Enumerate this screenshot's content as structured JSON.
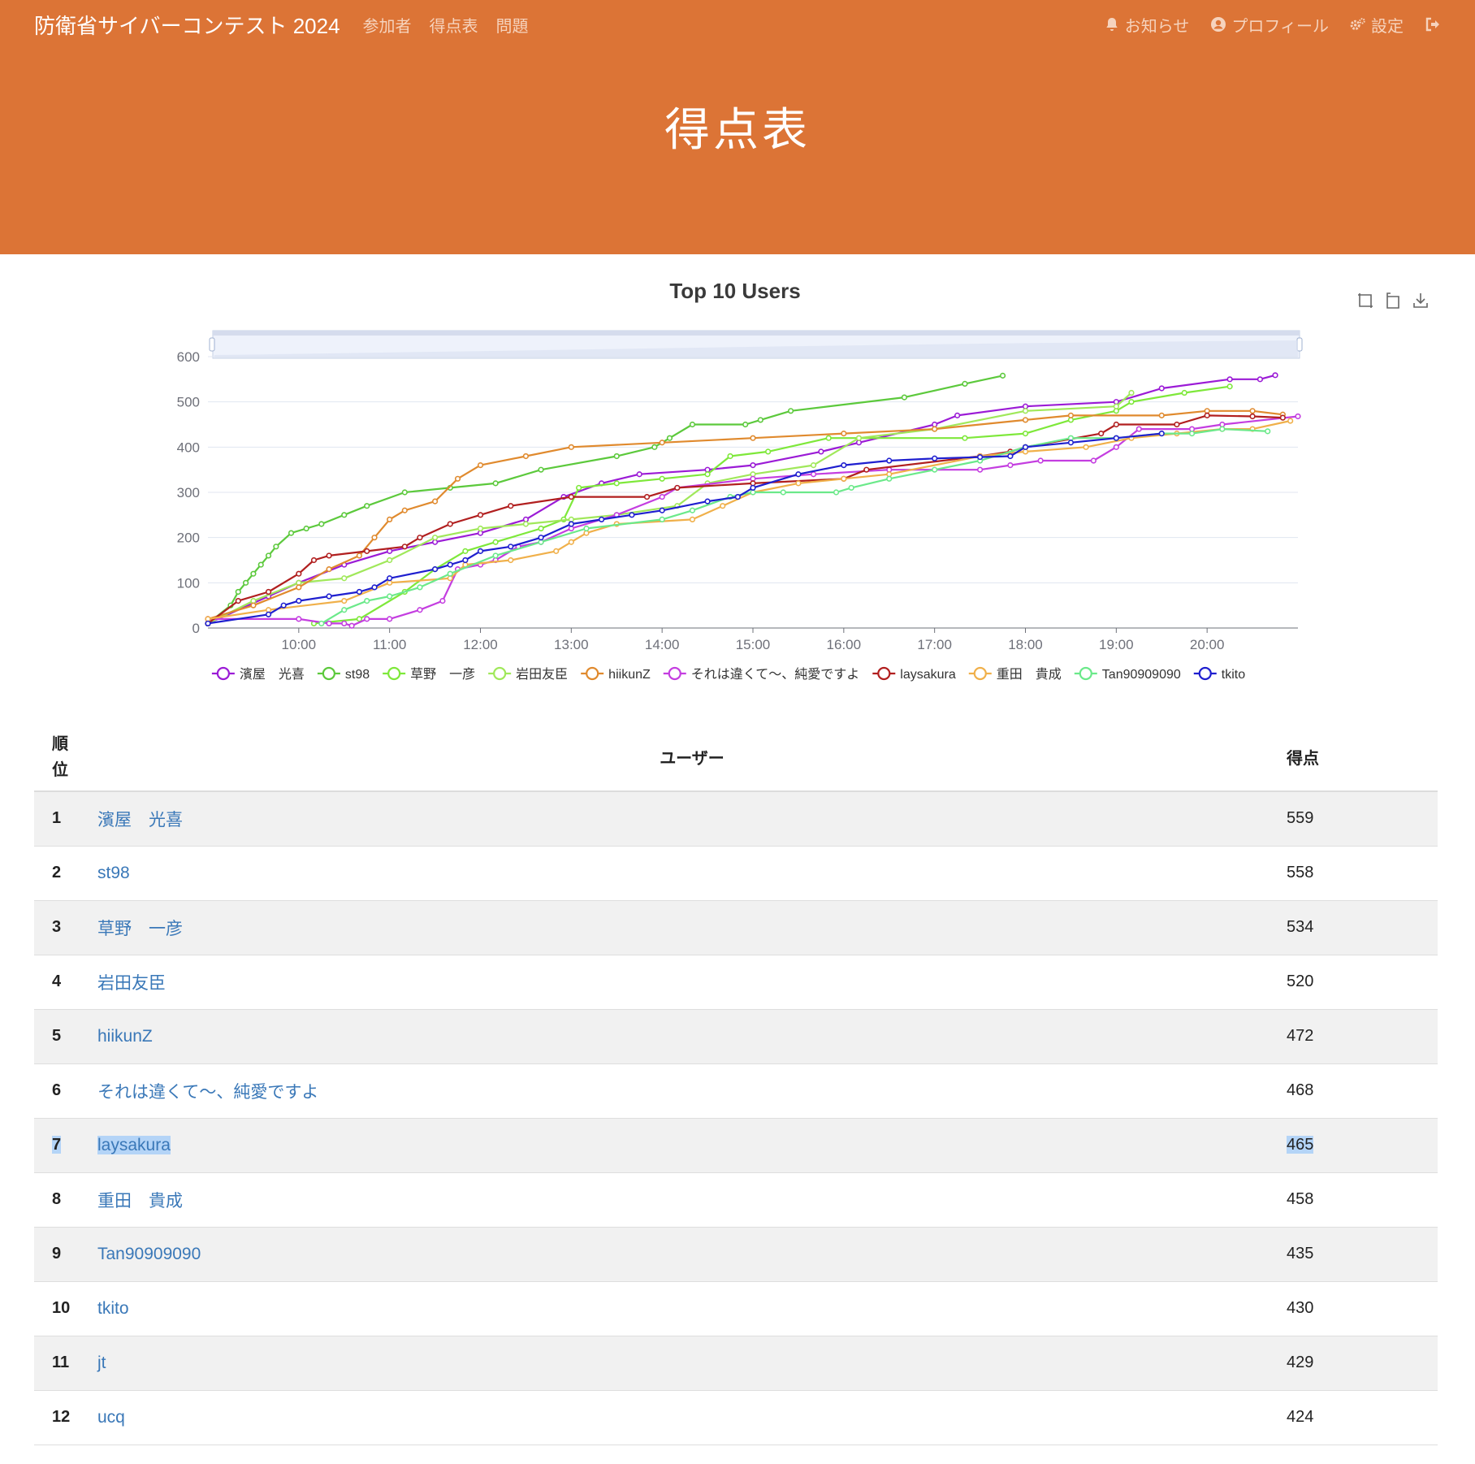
{
  "navbar": {
    "brand": "防衛省サイバーコンテスト 2024",
    "links": [
      "参加者",
      "得点表",
      "問題"
    ],
    "notifications": "お知らせ",
    "profile": "プロフィール",
    "settings": "設定"
  },
  "page": {
    "title": "得点表"
  },
  "table": {
    "headers": {
      "rank": "順位",
      "user": "ユーザー",
      "score": "得点"
    },
    "rows": [
      {
        "rank": "1",
        "user": "濱屋　光喜",
        "score": "559"
      },
      {
        "rank": "2",
        "user": "st98",
        "score": "558"
      },
      {
        "rank": "3",
        "user": "草野　一彦",
        "score": "534"
      },
      {
        "rank": "4",
        "user": "岩田友臣",
        "score": "520"
      },
      {
        "rank": "5",
        "user": "hiikunZ",
        "score": "472"
      },
      {
        "rank": "6",
        "user": "それは違くて〜、純愛ですよ",
        "score": "468"
      },
      {
        "rank": "7",
        "user": "laysakura",
        "score": "465"
      },
      {
        "rank": "8",
        "user": "重田　貴成",
        "score": "458"
      },
      {
        "rank": "9",
        "user": "Tan90909090",
        "score": "435"
      },
      {
        "rank": "10",
        "user": "tkito",
        "score": "430"
      },
      {
        "rank": "11",
        "user": "jt",
        "score": "429"
      },
      {
        "rank": "12",
        "user": "ucq",
        "score": "424"
      }
    ]
  },
  "chart_data": {
    "type": "line",
    "title": "Top 10 Users",
    "x_ticks": [
      "10:00",
      "11:00",
      "12:00",
      "13:00",
      "14:00",
      "15:00",
      "16:00",
      "17:00",
      "18:00",
      "19:00",
      "20:00"
    ],
    "xlim": [
      "09:00",
      "21:00"
    ],
    "y_ticks": [
      0,
      100,
      200,
      300,
      400,
      500,
      600
    ],
    "ylim": [
      0,
      600
    ],
    "grid": true,
    "legend_position": "bottom",
    "series": [
      {
        "name": "濱屋　光喜",
        "color": "#9b1bd6",
        "points": [
          [
            "09:00",
            10
          ],
          [
            "09:40",
            70
          ],
          [
            "10:00",
            100
          ],
          [
            "10:30",
            140
          ],
          [
            "11:00",
            170
          ],
          [
            "11:30",
            190
          ],
          [
            "12:00",
            210
          ],
          [
            "12:30",
            240
          ],
          [
            "12:55",
            290
          ],
          [
            "13:20",
            320
          ],
          [
            "13:45",
            340
          ],
          [
            "14:30",
            350
          ],
          [
            "15:00",
            360
          ],
          [
            "15:45",
            390
          ],
          [
            "16:10",
            410
          ],
          [
            "17:00",
            450
          ],
          [
            "17:15",
            470
          ],
          [
            "18:00",
            490
          ],
          [
            "19:00",
            500
          ],
          [
            "19:30",
            530
          ],
          [
            "20:15",
            550
          ],
          [
            "20:35",
            550
          ],
          [
            "20:45",
            559
          ]
        ]
      },
      {
        "name": "st98",
        "color": "#5cc93c",
        "points": [
          [
            "09:00",
            10
          ],
          [
            "09:15",
            50
          ],
          [
            "09:20",
            80
          ],
          [
            "09:25",
            100
          ],
          [
            "09:30",
            120
          ],
          [
            "09:35",
            140
          ],
          [
            "09:40",
            160
          ],
          [
            "09:45",
            180
          ],
          [
            "09:55",
            210
          ],
          [
            "10:05",
            220
          ],
          [
            "10:15",
            230
          ],
          [
            "10:30",
            250
          ],
          [
            "10:45",
            270
          ],
          [
            "11:10",
            300
          ],
          [
            "11:40",
            310
          ],
          [
            "12:10",
            320
          ],
          [
            "12:40",
            350
          ],
          [
            "13:30",
            380
          ],
          [
            "13:55",
            400
          ],
          [
            "14:05",
            420
          ],
          [
            "14:20",
            450
          ],
          [
            "14:55",
            450
          ],
          [
            "15:05",
            460
          ],
          [
            "15:25",
            480
          ],
          [
            "16:40",
            510
          ],
          [
            "17:20",
            540
          ],
          [
            "17:45",
            558
          ]
        ]
      },
      {
        "name": "草野　一彦",
        "color": "#7ee83a",
        "points": [
          [
            "10:10",
            10
          ],
          [
            "10:40",
            20
          ],
          [
            "11:10",
            80
          ],
          [
            "11:30",
            130
          ],
          [
            "11:50",
            170
          ],
          [
            "12:10",
            190
          ],
          [
            "12:40",
            220
          ],
          [
            "12:55",
            240
          ],
          [
            "13:05",
            310
          ],
          [
            "13:30",
            320
          ],
          [
            "14:00",
            330
          ],
          [
            "14:30",
            340
          ],
          [
            "14:45",
            380
          ],
          [
            "15:10",
            390
          ],
          [
            "15:50",
            420
          ],
          [
            "17:20",
            420
          ],
          [
            "18:00",
            430
          ],
          [
            "18:30",
            460
          ],
          [
            "19:00",
            480
          ],
          [
            "19:10",
            500
          ],
          [
            "19:45",
            520
          ],
          [
            "20:15",
            534
          ]
        ]
      },
      {
        "name": "岩田友臣",
        "color": "#a0e85a",
        "points": [
          [
            "09:00",
            10
          ],
          [
            "09:30",
            60
          ],
          [
            "10:00",
            100
          ],
          [
            "10:30",
            110
          ],
          [
            "11:00",
            150
          ],
          [
            "11:30",
            200
          ],
          [
            "12:00",
            220
          ],
          [
            "12:30",
            230
          ],
          [
            "13:00",
            240
          ],
          [
            "13:30",
            250
          ],
          [
            "14:10",
            270
          ],
          [
            "14:30",
            320
          ],
          [
            "15:00",
            340
          ],
          [
            "15:40",
            360
          ],
          [
            "16:10",
            420
          ],
          [
            "17:00",
            440
          ],
          [
            "18:00",
            480
          ],
          [
            "19:00",
            490
          ],
          [
            "19:10",
            520
          ]
        ]
      },
      {
        "name": "hiikunZ",
        "color": "#e08a2e",
        "points": [
          [
            "09:00",
            20
          ],
          [
            "09:30",
            50
          ],
          [
            "10:00",
            90
          ],
          [
            "10:20",
            130
          ],
          [
            "10:40",
            160
          ],
          [
            "10:50",
            200
          ],
          [
            "11:00",
            240
          ],
          [
            "11:10",
            260
          ],
          [
            "11:30",
            280
          ],
          [
            "11:45",
            330
          ],
          [
            "12:00",
            360
          ],
          [
            "12:30",
            380
          ],
          [
            "13:00",
            400
          ],
          [
            "14:00",
            410
          ],
          [
            "15:00",
            420
          ],
          [
            "16:00",
            430
          ],
          [
            "17:00",
            440
          ],
          [
            "18:00",
            460
          ],
          [
            "18:30",
            470
          ],
          [
            "19:30",
            470
          ],
          [
            "20:00",
            480
          ],
          [
            "20:30",
            480
          ],
          [
            "20:50",
            472
          ]
        ]
      },
      {
        "name": "それは違くて〜、純愛ですよ",
        "color": "#c43ee0",
        "points": [
          [
            "09:00",
            20
          ],
          [
            "10:00",
            20
          ],
          [
            "10:20",
            10
          ],
          [
            "10:30",
            10
          ],
          [
            "10:35",
            5
          ],
          [
            "10:45",
            20
          ],
          [
            "11:00",
            20
          ],
          [
            "11:20",
            40
          ],
          [
            "11:35",
            60
          ],
          [
            "11:45",
            130
          ],
          [
            "12:00",
            140
          ],
          [
            "12:10",
            150
          ],
          [
            "12:25",
            180
          ],
          [
            "12:40",
            190
          ],
          [
            "13:00",
            220
          ],
          [
            "13:30",
            250
          ],
          [
            "14:00",
            290
          ],
          [
            "14:10",
            310
          ],
          [
            "15:00",
            330
          ],
          [
            "15:40",
            340
          ],
          [
            "16:30",
            350
          ],
          [
            "17:30",
            350
          ],
          [
            "17:50",
            360
          ],
          [
            "18:10",
            370
          ],
          [
            "18:45",
            370
          ],
          [
            "19:00",
            400
          ],
          [
            "19:15",
            440
          ],
          [
            "19:50",
            440
          ],
          [
            "20:10",
            450
          ],
          [
            "21:00",
            468
          ]
        ]
      },
      {
        "name": "laysakura",
        "color": "#b11f1f",
        "points": [
          [
            "09:00",
            10
          ],
          [
            "09:20",
            60
          ],
          [
            "09:40",
            80
          ],
          [
            "10:00",
            120
          ],
          [
            "10:10",
            150
          ],
          [
            "10:20",
            160
          ],
          [
            "10:45",
            170
          ],
          [
            "11:10",
            180
          ],
          [
            "11:20",
            200
          ],
          [
            "11:40",
            230
          ],
          [
            "12:00",
            250
          ],
          [
            "12:20",
            270
          ],
          [
            "13:00",
            290
          ],
          [
            "13:50",
            290
          ],
          [
            "14:10",
            310
          ],
          [
            "15:00",
            320
          ],
          [
            "16:00",
            330
          ],
          [
            "16:15",
            350
          ],
          [
            "17:30",
            380
          ],
          [
            "17:50",
            390
          ],
          [
            "18:00",
            400
          ],
          [
            "18:50",
            430
          ],
          [
            "19:00",
            450
          ],
          [
            "19:40",
            450
          ],
          [
            "20:00",
            470
          ],
          [
            "20:30",
            468
          ],
          [
            "20:50",
            465
          ]
        ]
      },
      {
        "name": "重田　貴成",
        "color": "#f0b04a",
        "points": [
          [
            "09:00",
            20
          ],
          [
            "09:40",
            40
          ],
          [
            "10:30",
            60
          ],
          [
            "11:00",
            100
          ],
          [
            "11:40",
            110
          ],
          [
            "11:50",
            140
          ],
          [
            "12:20",
            150
          ],
          [
            "12:50",
            170
          ],
          [
            "13:00",
            190
          ],
          [
            "13:10",
            210
          ],
          [
            "13:30",
            230
          ],
          [
            "14:20",
            240
          ],
          [
            "14:40",
            270
          ],
          [
            "15:00",
            300
          ],
          [
            "15:30",
            320
          ],
          [
            "16:00",
            330
          ],
          [
            "16:30",
            340
          ],
          [
            "17:30",
            380
          ],
          [
            "18:00",
            390
          ],
          [
            "18:40",
            400
          ],
          [
            "19:10",
            420
          ],
          [
            "19:40",
            430
          ],
          [
            "20:10",
            440
          ],
          [
            "20:30",
            440
          ],
          [
            "20:55",
            458
          ]
        ]
      },
      {
        "name": "Tan90909090",
        "color": "#6be98a",
        "points": [
          [
            "10:15",
            10
          ],
          [
            "10:30",
            40
          ],
          [
            "10:45",
            60
          ],
          [
            "11:00",
            70
          ],
          [
            "11:20",
            90
          ],
          [
            "11:40",
            120
          ],
          [
            "12:10",
            160
          ],
          [
            "12:40",
            190
          ],
          [
            "13:10",
            220
          ],
          [
            "14:00",
            240
          ],
          [
            "14:20",
            260
          ],
          [
            "14:45",
            290
          ],
          [
            "15:00",
            300
          ],
          [
            "15:20",
            300
          ],
          [
            "15:55",
            300
          ],
          [
            "16:05",
            310
          ],
          [
            "16:30",
            330
          ],
          [
            "17:00",
            350
          ],
          [
            "17:30",
            370
          ],
          [
            "18:00",
            400
          ],
          [
            "18:30",
            420
          ],
          [
            "19:00",
            420
          ],
          [
            "19:30",
            430
          ],
          [
            "19:50",
            430
          ],
          [
            "20:10",
            440
          ],
          [
            "20:40",
            435
          ]
        ]
      },
      {
        "name": "tkito",
        "color": "#1f1fcf",
        "points": [
          [
            "09:00",
            10
          ],
          [
            "09:40",
            30
          ],
          [
            "09:50",
            50
          ],
          [
            "10:00",
            60
          ],
          [
            "10:20",
            70
          ],
          [
            "10:40",
            80
          ],
          [
            "10:50",
            90
          ],
          [
            "11:00",
            110
          ],
          [
            "11:30",
            130
          ],
          [
            "11:40",
            140
          ],
          [
            "11:50",
            150
          ],
          [
            "12:00",
            170
          ],
          [
            "12:20",
            180
          ],
          [
            "12:40",
            200
          ],
          [
            "13:00",
            230
          ],
          [
            "13:20",
            240
          ],
          [
            "13:40",
            250
          ],
          [
            "14:00",
            260
          ],
          [
            "14:30",
            280
          ],
          [
            "14:50",
            290
          ],
          [
            "15:00",
            310
          ],
          [
            "15:30",
            340
          ],
          [
            "16:00",
            360
          ],
          [
            "16:30",
            370
          ],
          [
            "17:00",
            375
          ],
          [
            "17:30",
            378
          ],
          [
            "17:50",
            380
          ],
          [
            "18:00",
            400
          ],
          [
            "18:30",
            410
          ],
          [
            "19:00",
            420
          ],
          [
            "19:30",
            430
          ]
        ]
      }
    ]
  }
}
